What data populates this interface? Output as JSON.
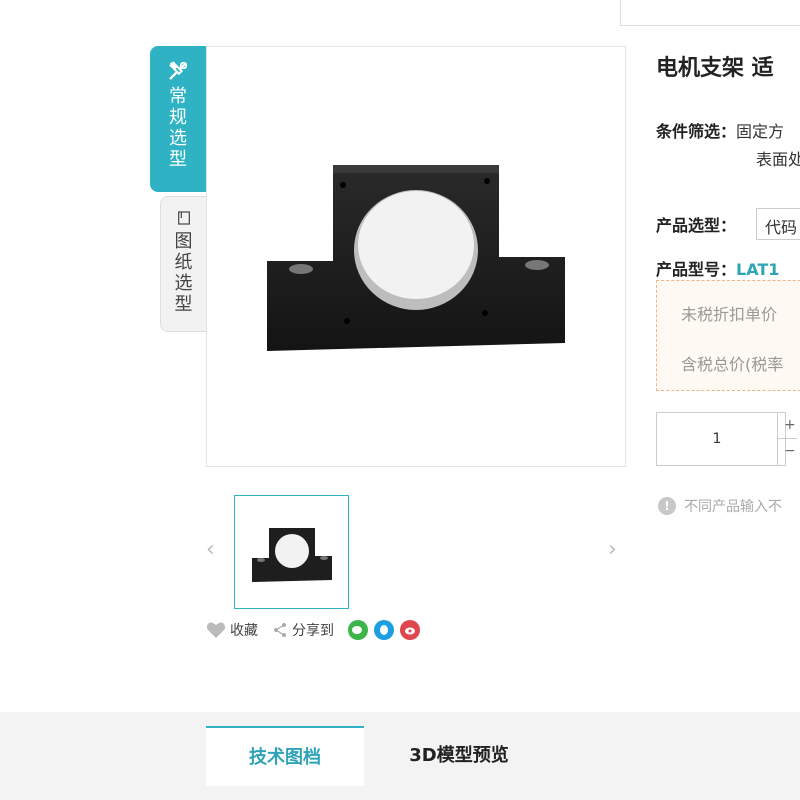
{
  "side_tabs": {
    "active": {
      "label": "常规选型",
      "icon": "tools-icon"
    },
    "inactive": {
      "label": "图纸选型",
      "icon": "drawing-icon"
    }
  },
  "product": {
    "title": "电机支架 适",
    "image_alt": "motor-mount-bracket-photo"
  },
  "carousel": {
    "prev": "‹",
    "next": "›"
  },
  "actions": {
    "favorite": "收藏",
    "share": "分享到",
    "social_icons": [
      "wechat-icon",
      "qq-icon",
      "weibo-icon"
    ]
  },
  "info": {
    "filter_label": "条件筛选：",
    "filter_value_line1": "固定方",
    "filter_value_line2": "表面处",
    "select_label": "产品选型：",
    "select_value": "代码",
    "model_label": "产品型号：",
    "model_value": "LAT1"
  },
  "price": {
    "untaxed": "未税折扣单价",
    "taxed": "含税总价(税率"
  },
  "quantity": {
    "value": "1",
    "plus": "+",
    "minus": "−"
  },
  "note": {
    "text": "不同产品输入不"
  },
  "bottom_tabs": {
    "active": "技术图档",
    "other": "3D模型预览"
  },
  "colors": {
    "accent": "#2fb3c4",
    "price_border": "#f0b48a"
  }
}
